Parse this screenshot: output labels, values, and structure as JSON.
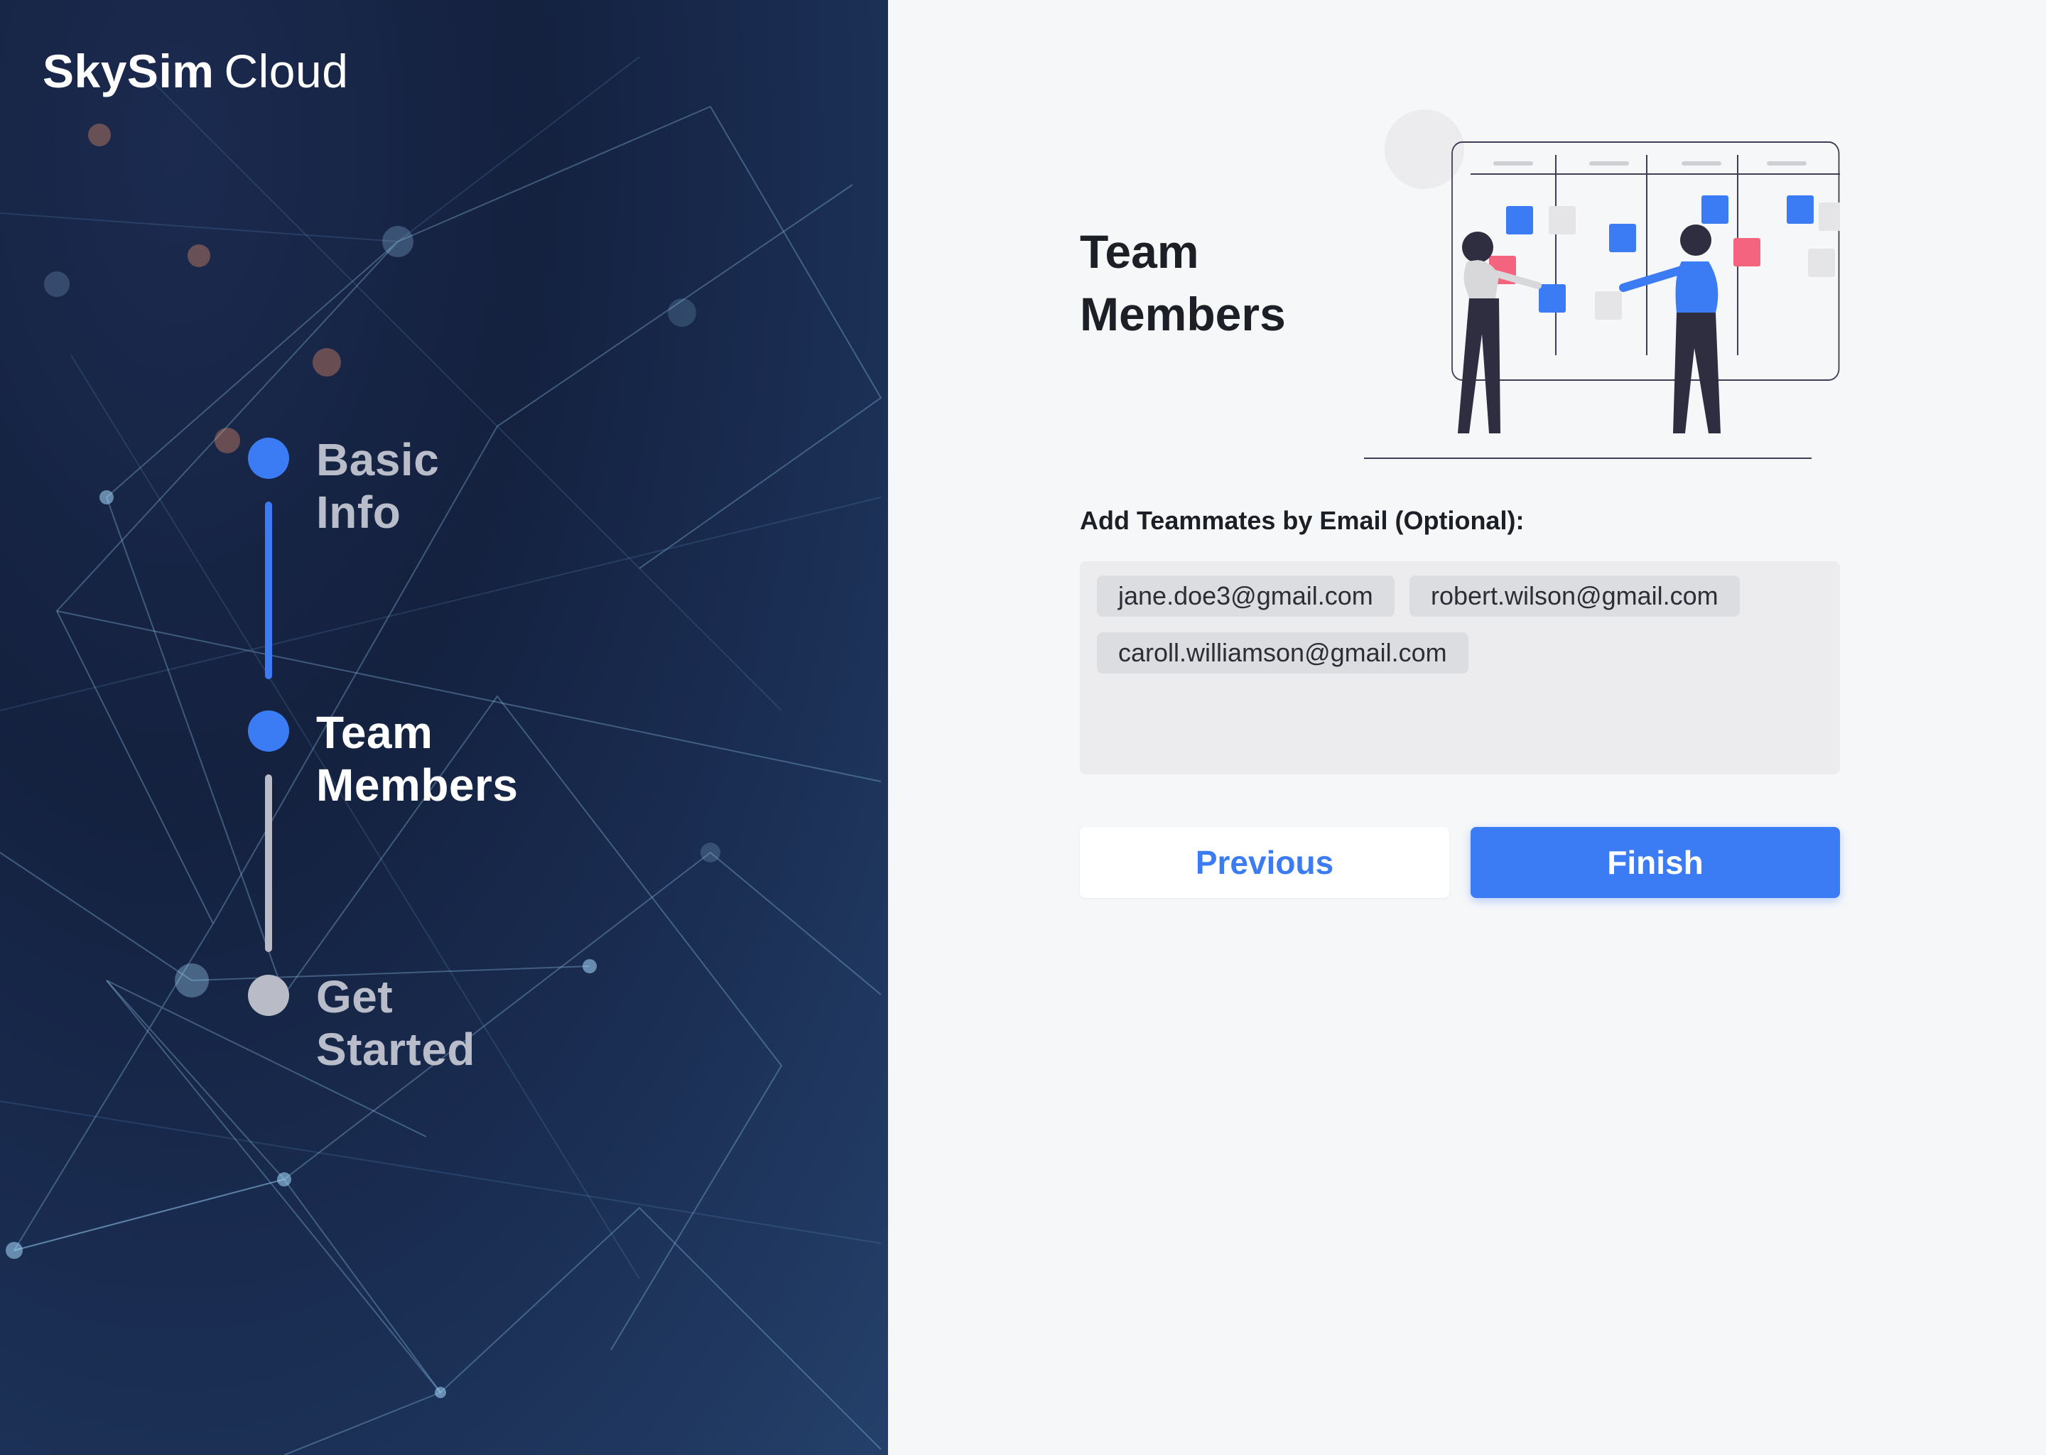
{
  "brand": {
    "name_bold": "SkySim",
    "name_light": "Cloud"
  },
  "steps": [
    {
      "label": "Basic Info",
      "status": "done"
    },
    {
      "label": "Team Members",
      "status": "active"
    },
    {
      "label": "Get Started",
      "status": "todo"
    }
  ],
  "main": {
    "title_line1": "Team",
    "title_line2": "Members",
    "email_label": "Add Teammates by Email (Optional):",
    "emails": [
      "jane.doe3@gmail.com",
      "robert.wilson@gmail.com",
      "caroll.williamson@gmail.com"
    ],
    "previous_label": "Previous",
    "finish_label": "Finish"
  },
  "colors": {
    "accent": "#3b7cf5",
    "pink": "#f5647f",
    "sidebar_dark": "#14213f",
    "inactive_step": "#b9bcc6"
  },
  "icons": {
    "illustration": "team-kanban-board-illustration"
  }
}
